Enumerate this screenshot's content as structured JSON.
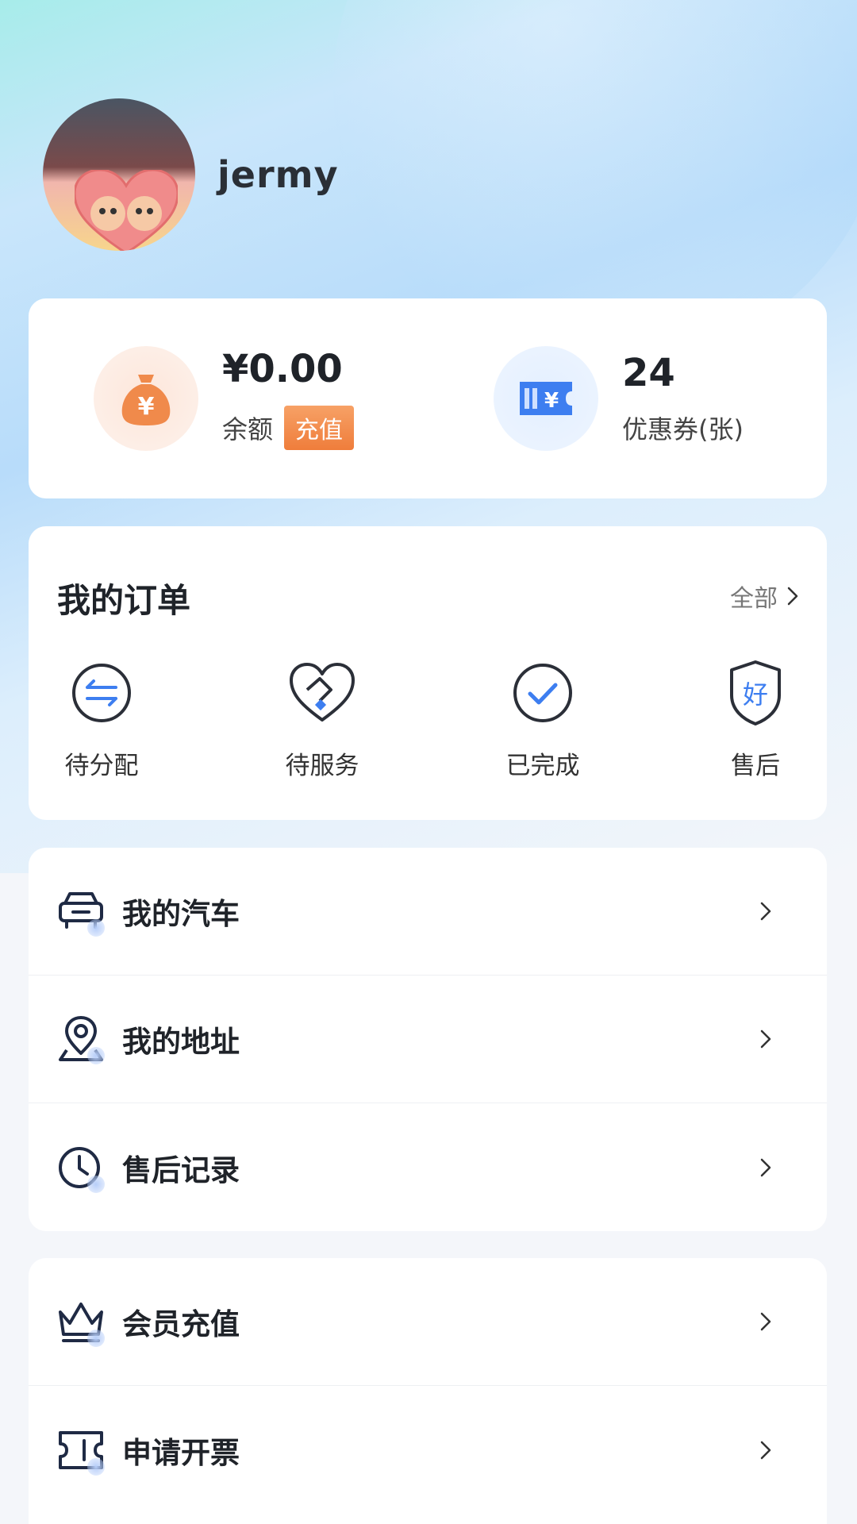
{
  "profile": {
    "username": "jermy"
  },
  "wallet": {
    "balance_amount": "¥0.00",
    "balance_label": "余额",
    "recharge_label": "充值",
    "coupon_count": "24",
    "coupon_label": "优惠券(张)"
  },
  "orders": {
    "title": "我的订单",
    "all_label": "全部",
    "items": [
      {
        "label": "待分配",
        "icon": "transfer-arrows-icon"
      },
      {
        "label": "待服务",
        "icon": "handshake-heart-icon"
      },
      {
        "label": "已完成",
        "icon": "check-circle-icon"
      },
      {
        "label": "售后",
        "icon": "shield-good-icon"
      }
    ],
    "aftersale_glyph": "好"
  },
  "menu_group_1": [
    {
      "label": "我的汽车",
      "icon": "car-icon"
    },
    {
      "label": "我的地址",
      "icon": "location-pin-icon"
    },
    {
      "label": "售后记录",
      "icon": "clock-icon"
    }
  ],
  "menu_group_2": [
    {
      "label": "会员充值",
      "icon": "crown-icon"
    },
    {
      "label": "申请开票",
      "icon": "ticket-icon"
    }
  ],
  "colors": {
    "accent_blue": "#3d7ef0",
    "accent_orange": "#ef7d3b",
    "icon_dark": "#1f2a44"
  }
}
